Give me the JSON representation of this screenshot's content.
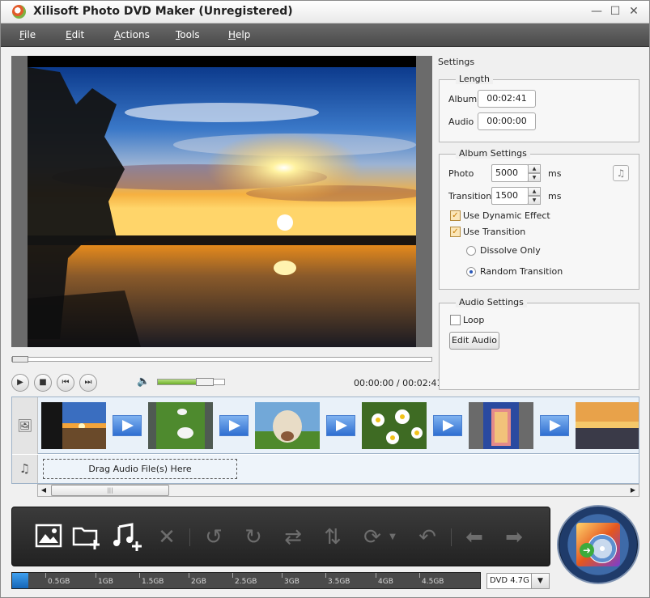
{
  "window": {
    "title": "Xilisoft Photo DVD Maker (Unregistered)",
    "controls": {
      "minimize": "—",
      "maximize": "☐",
      "close": "✕"
    }
  },
  "menu": [
    "File",
    "Edit",
    "Actions",
    "Tools",
    "Help"
  ],
  "player": {
    "time": "00:00:00 / 00:02:41",
    "seek_position": 0,
    "volume_level": 0.7,
    "buttons": [
      "play-icon",
      "stop-icon",
      "previous-icon",
      "next-icon"
    ]
  },
  "settings": {
    "title": "Settings",
    "length": {
      "legend": "Length",
      "album_label": "Album",
      "album_value": "00:02:41",
      "audio_label": "Audio",
      "audio_value": "00:00:00"
    },
    "album": {
      "legend": "Album Settings",
      "photo_label": "Photo",
      "photo_value": "5000",
      "photo_unit": "ms",
      "transition_label": "Transition",
      "transition_value": "1500",
      "transition_unit": "ms",
      "dynamic_effect_label": "Use Dynamic Effect",
      "dynamic_effect_checked": true,
      "use_transition_label": "Use Transition",
      "use_transition_checked": true,
      "dissolve_label": "Dissolve Only",
      "random_label": "Random Transition",
      "selected_transition": "Random Transition"
    },
    "audio": {
      "legend": "Audio Settings",
      "loop_label": "Loop",
      "loop_checked": false,
      "edit_audio_label": "Edit Audio"
    }
  },
  "timeline": {
    "photos": [
      "sunset-lake",
      "white-birds",
      "goat",
      "daisies",
      "building",
      "sea-sunset"
    ],
    "audio_drop_text": "Drag Audio File(s) Here"
  },
  "toolbar": {
    "tools": [
      "add-photo-icon",
      "add-folder-icon",
      "add-audio-icon",
      "delete-icon",
      "rotate-left-icon",
      "rotate-right-icon",
      "swap-icon",
      "sort-icon",
      "transition-icon",
      "undo-icon",
      "move-left-icon",
      "move-right-icon"
    ]
  },
  "capacity": {
    "used_fraction": 0.035,
    "ticks": [
      "0.5GB",
      "1GB",
      "1.5GB",
      "2GB",
      "2.5GB",
      "3GB",
      "3.5GB",
      "4GB",
      "4.5GB"
    ],
    "disc_type": "DVD 4.7G"
  },
  "colors": {
    "menubar": "#555555",
    "capacity_fill": "#2b86d8",
    "transition_blue": "#2f6fd1"
  }
}
